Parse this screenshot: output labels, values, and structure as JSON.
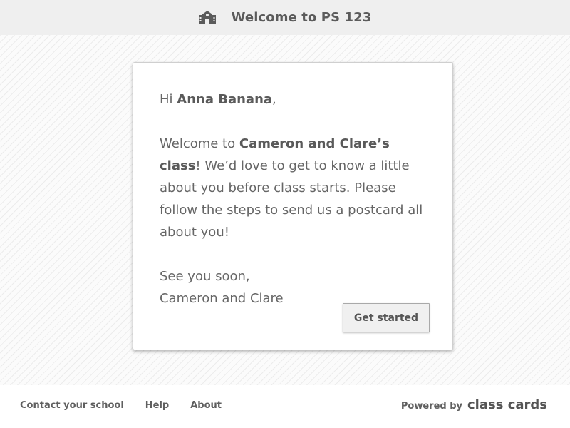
{
  "header": {
    "icon": "school-building-icon",
    "title": "Welcome to PS 123"
  },
  "card": {
    "greeting_prefix": "Hi ",
    "student_name": "Anna Banana",
    "greeting_suffix": ",",
    "welcome_prefix": "Welcome to ",
    "class_name": "Cameron and Clare’s class",
    "welcome_suffix": "!",
    "message": "We’d love to get to know a little about you before class starts. Please follow the steps to send us a postcard all about you!",
    "signoff": "See you soon,",
    "teachers": "Cameron and Clare",
    "button_label": "Get started"
  },
  "footer": {
    "links": [
      "Contact your school",
      "Help",
      "About"
    ],
    "powered_by": "Powered by",
    "brand": "class cards"
  },
  "colors": {
    "header_bg": "#efefef",
    "text": "#5f5f5f",
    "button_bg": "#f0f0f0"
  }
}
